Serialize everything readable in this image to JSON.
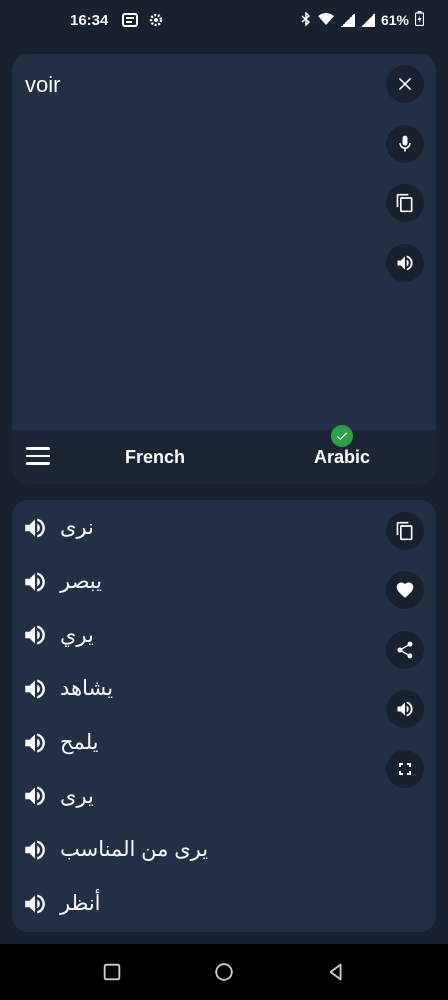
{
  "status_bar": {
    "time": "16:34",
    "battery": "61%"
  },
  "input": {
    "text": "voir"
  },
  "languages": {
    "source": "French",
    "target": "Arabic"
  },
  "results": [
    {
      "text": "نرى"
    },
    {
      "text": "يبصر"
    },
    {
      "text": "يري"
    },
    {
      "text": "يشاهد"
    },
    {
      "text": "يلمح"
    },
    {
      "text": "يرى"
    },
    {
      "text": "يرى من المناسب"
    },
    {
      "text": "أنظر"
    }
  ],
  "icons": {
    "close": "close-icon",
    "mic": "microphone-icon",
    "copy": "copy-icon",
    "speaker": "speaker-icon",
    "heart": "heart-icon",
    "share": "share-icon",
    "fullscreen": "fullscreen-icon",
    "menu": "menu-icon",
    "check": "check-icon"
  },
  "colors": {
    "background": "#17212f",
    "panel": "#223045",
    "lang_bar": "#1a2636",
    "check": "#2f9e48"
  }
}
